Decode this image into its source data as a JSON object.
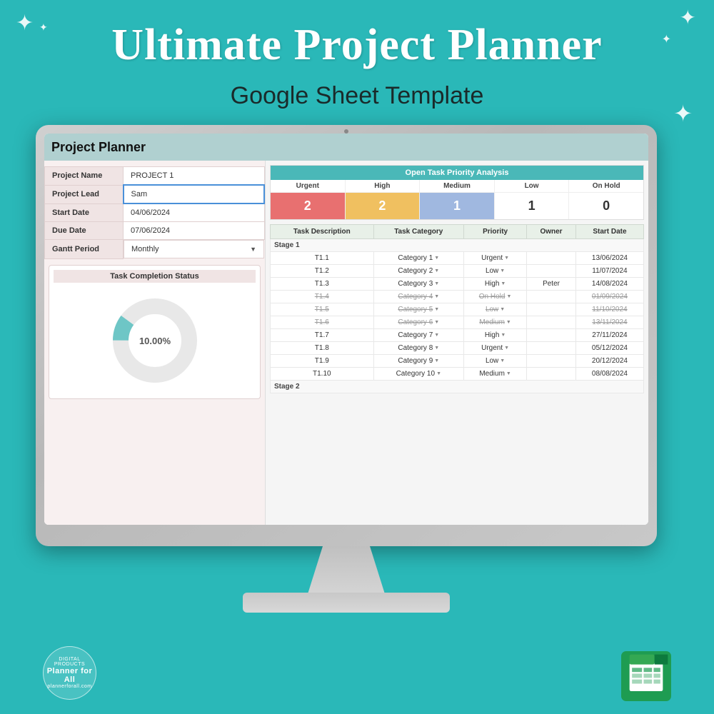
{
  "header": {
    "title": "Ultimate Project Planner",
    "subtitle": "Google Sheet Template"
  },
  "sparkles": [
    "✦",
    "✦",
    "✦",
    "✦",
    "✦",
    "✦"
  ],
  "sheet": {
    "title": "Project Planner",
    "info_rows": [
      {
        "label": "Project Name",
        "value": "PROJECT 1",
        "highlighted": false
      },
      {
        "label": "Project Lead",
        "value": "Sam",
        "highlighted": true
      },
      {
        "label": "Start Date",
        "value": "04/06/2024",
        "highlighted": false
      },
      {
        "label": "Due Date",
        "value": "07/06/2024",
        "highlighted": false
      },
      {
        "label": "Gantt Period",
        "value": "Monthly",
        "highlighted": false,
        "dropdown": true
      }
    ],
    "task_completion": {
      "title": "Task Completion Status",
      "percentage": "10.00%",
      "chart": {
        "filled": 10,
        "total": 100,
        "color_fill": "#6ec6c6",
        "color_empty": "#e8e8e8"
      }
    },
    "priority_analysis": {
      "title": "Open Task Priority Analysis",
      "columns": [
        {
          "label": "Urgent",
          "value": "2",
          "bg_class": "urgent-bg"
        },
        {
          "label": "High",
          "value": "2",
          "bg_class": "high-bg"
        },
        {
          "label": "Medium",
          "value": "1",
          "bg_class": "medium-bg"
        },
        {
          "label": "Low",
          "value": "1",
          "bg_class": "low-bg"
        },
        {
          "label": "On Hold",
          "value": "0",
          "bg_class": "onhold-bg"
        }
      ]
    },
    "task_table": {
      "headers": [
        "Task Description",
        "Task Category",
        "Priority",
        "Owner",
        "Start Date"
      ],
      "stages": [
        {
          "stage_label": "Stage 1",
          "tasks": [
            {
              "id": "T1.1",
              "category": "Category 1",
              "priority": "Urgent",
              "owner": "",
              "start_date": "13/06/2024",
              "strikethrough": false
            },
            {
              "id": "T1.2",
              "category": "Category 2",
              "priority": "Low",
              "owner": "",
              "start_date": "11/07/2024",
              "strikethrough": false
            },
            {
              "id": "T1.3",
              "category": "Category 3",
              "priority": "High",
              "owner": "Peter",
              "start_date": "14/08/2024",
              "strikethrough": false
            },
            {
              "id": "T1.4",
              "category": "Category 4",
              "priority": "On Hold",
              "owner": "",
              "start_date": "01/09/2024",
              "strikethrough": true
            },
            {
              "id": "T1.5",
              "category": "Category 5",
              "priority": "Low",
              "owner": "",
              "start_date": "11/10/2024",
              "strikethrough": true
            },
            {
              "id": "T1.6",
              "category": "Category 6",
              "priority": "Medium",
              "owner": "",
              "start_date": "13/11/2024",
              "strikethrough": true
            },
            {
              "id": "T1.7",
              "category": "Category 7",
              "priority": "High",
              "owner": "",
              "start_date": "27/11/2024",
              "strikethrough": false
            },
            {
              "id": "T1.8",
              "category": "Category 8",
              "priority": "Urgent",
              "owner": "",
              "start_date": "05/12/2024",
              "strikethrough": false
            },
            {
              "id": "T1.9",
              "category": "Category 9",
              "priority": "Low",
              "owner": "",
              "start_date": "20/12/2024",
              "strikethrough": false
            },
            {
              "id": "T1.10",
              "category": "Category 10",
              "priority": "Medium",
              "owner": "",
              "start_date": "08/08/2024",
              "strikethrough": false
            }
          ]
        },
        {
          "stage_label": "Stage 2",
          "tasks": []
        }
      ]
    }
  },
  "branding": {
    "left_top": "DIGITAL PRODUCTS",
    "left_main": "Planner for All",
    "left_bottom": "plannerforall.com"
  }
}
